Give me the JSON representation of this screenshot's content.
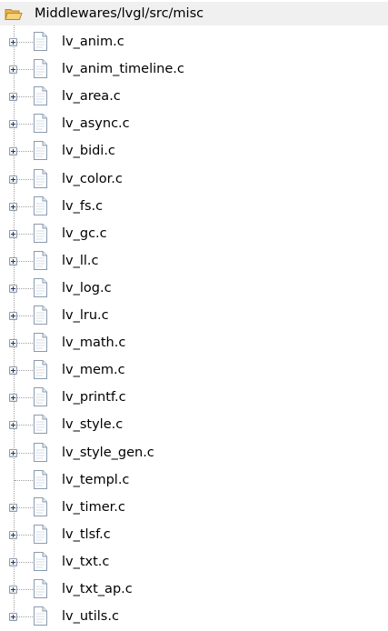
{
  "folder": {
    "label": "Middlewares/lvgl/src/misc",
    "icon": "open-folder-icon"
  },
  "files": [
    {
      "label": "lv_anim.c",
      "expandable": true
    },
    {
      "label": "lv_anim_timeline.c",
      "expandable": true
    },
    {
      "label": "lv_area.c",
      "expandable": true
    },
    {
      "label": "lv_async.c",
      "expandable": true
    },
    {
      "label": "lv_bidi.c",
      "expandable": true
    },
    {
      "label": "lv_color.c",
      "expandable": true
    },
    {
      "label": "lv_fs.c",
      "expandable": true
    },
    {
      "label": "lv_gc.c",
      "expandable": true
    },
    {
      "label": "lv_ll.c",
      "expandable": true
    },
    {
      "label": "lv_log.c",
      "expandable": true
    },
    {
      "label": "lv_lru.c",
      "expandable": true
    },
    {
      "label": "lv_math.c",
      "expandable": true
    },
    {
      "label": "lv_mem.c",
      "expandable": true
    },
    {
      "label": "lv_printf.c",
      "expandable": true
    },
    {
      "label": "lv_style.c",
      "expandable": true
    },
    {
      "label": "lv_style_gen.c",
      "expandable": true
    },
    {
      "label": "lv_templ.c",
      "expandable": false
    },
    {
      "label": "lv_timer.c",
      "expandable": true
    },
    {
      "label": "lv_tlsf.c",
      "expandable": true
    },
    {
      "label": "lv_txt.c",
      "expandable": true
    },
    {
      "label": "lv_txt_ap.c",
      "expandable": true
    },
    {
      "label": "lv_utils.c",
      "expandable": true
    }
  ],
  "colors": {
    "folder_row_background": "#f0f0f0",
    "tree_line": "#a0a0a0",
    "folder_fill": "#f2c55c",
    "file_page": "#ffffff",
    "file_border": "#8a9bb0"
  }
}
